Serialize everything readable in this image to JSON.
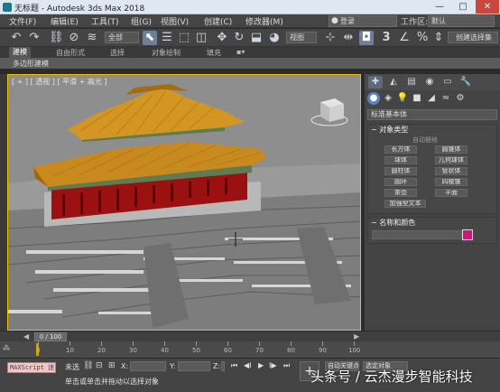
{
  "window": {
    "title": "无标题 - Autodesk 3ds Max 2018",
    "minimize": "—",
    "maximize": "□",
    "close": "✕"
  },
  "menu": {
    "items": [
      "文件(F)",
      "编辑(E)",
      "工具(T)",
      "组(G)",
      "视图(V)",
      "创建(C)",
      "修改器(M)"
    ],
    "search_value": "登录",
    "workspace_label": "工作区:",
    "workspace_value": "默认"
  },
  "toolbar": {
    "filter_value": "全部",
    "view_value": "视图",
    "selection_set_value": "创建选择集",
    "icons": [
      "undo-icon",
      "redo-icon",
      "link-icon",
      "unlink-icon",
      "bind-spacewarp-icon",
      "select-object-icon",
      "select-by-name-icon",
      "rect-selection-icon",
      "window-crossing-icon",
      "move-icon",
      "rotate-icon",
      "scale-icon",
      "place-icon",
      "pivot-icon",
      "snap-3-icon",
      "angle-snap-icon",
      "percent-snap-icon",
      "spinner-snap-icon"
    ]
  },
  "ribbon": {
    "tabs": [
      "建模",
      "自由形式",
      "选择",
      "对象绘制",
      "填充"
    ],
    "active_tab": "建模",
    "sub_label": "多边形建模"
  },
  "viewport": {
    "label": "[ + ] [ 透视 ] [ 平滑 + 高光 ]"
  },
  "command_panel": {
    "category_value": "标准基本体",
    "object_type_header": "对象类型",
    "autogrid_label": "自动栅格",
    "object_buttons": [
      [
        "长方体",
        "圆锥体"
      ],
      [
        "球体",
        "几何球体"
      ],
      [
        "圆柱体",
        "管状体"
      ],
      [
        "圆环",
        "四棱锥"
      ],
      [
        "茶壶",
        "平面"
      ],
      [
        "加强型文本"
      ]
    ],
    "name_color_header": "名称和颜色",
    "object_color": "#c41a7a"
  },
  "timeline": {
    "frame_indicator": "0 / 100",
    "ruler_labels": [
      "0",
      "10",
      "20",
      "30",
      "40",
      "50",
      "60",
      "70",
      "80",
      "90",
      "100"
    ]
  },
  "status": {
    "maxscript": "MAXScript 迷",
    "selection_text": "未选",
    "prompt_text": "单击或单击并拖动以选择对象",
    "x_label": "X:",
    "y_label": "Y:",
    "z_label": "Z:",
    "autokey_label": "自动关键点",
    "selected_object": "选定对象",
    "setkey_label": "设置关键点",
    "filter_label": "关键点过滤器..."
  },
  "watermark": "头条号 / 云杰漫步智能科技"
}
